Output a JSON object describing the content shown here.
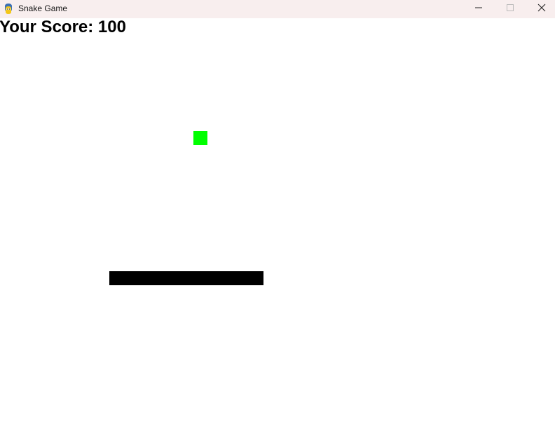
{
  "window": {
    "title": "Snake Game",
    "icon": "pygame-snake-icon",
    "controls": {
      "minimize_icon": "minimize-icon",
      "maximize_icon": "maximize-icon",
      "close_icon": "close-icon"
    }
  },
  "game": {
    "score_text": "Your Score: 100",
    "colors": {
      "background": "#ffffff",
      "titlebar": "#f8eeee",
      "food": "#00ff00",
      "snake": "#000000",
      "score_text": "#000000"
    },
    "snake_length": 11
  }
}
